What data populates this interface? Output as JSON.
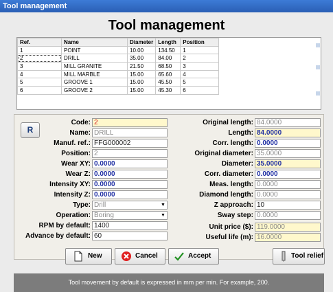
{
  "window": {
    "title": "Tool management"
  },
  "heading": "Tool management",
  "table": {
    "columns": [
      "Ref.",
      "Name",
      "Diameter",
      "Length",
      "Position"
    ],
    "rows": [
      [
        "1",
        "POINT",
        "10.00",
        "134.50",
        "1"
      ],
      [
        "2",
        "DRILL",
        "35.00",
        "84.00",
        "2"
      ],
      [
        "3",
        "MILL GRANITE",
        "21.50",
        "68.50",
        "3"
      ],
      [
        "4",
        "MILL MARBLE",
        "15.00",
        "65.60",
        "4"
      ],
      [
        "5",
        "GROOVE 1",
        "15.00",
        "45.50",
        "5"
      ],
      [
        "6",
        "GROOVE 2",
        "15.00",
        "45.30",
        "6"
      ]
    ]
  },
  "r_button": "R",
  "form_left": {
    "code": {
      "label": "Code:",
      "value": "2"
    },
    "name": {
      "label": "Name:",
      "value": "DRILL"
    },
    "manuf_ref": {
      "label": "Manuf. ref.:",
      "value": "FFG000002"
    },
    "position": {
      "label": "Position:",
      "value": "2"
    },
    "wear_xy": {
      "label": "Wear XY:",
      "value": "0.0000"
    },
    "wear_z": {
      "label": "Wear Z:",
      "value": "0.0000"
    },
    "intensity_xy": {
      "label": "Intensity XY:",
      "value": "0.0000"
    },
    "intensity_z": {
      "label": "Intensity Z:",
      "value": "0.0000"
    },
    "type": {
      "label": "Type:",
      "value": "Drill"
    },
    "operation": {
      "label": "Operation:",
      "value": "Boring"
    },
    "rpm_default": {
      "label": "RPM by default:",
      "value": "1400"
    },
    "advance_default": {
      "label": "Advance by default:",
      "value": "60"
    }
  },
  "form_right": {
    "original_length": {
      "label": "Original length:",
      "value": "84.0000"
    },
    "length": {
      "label": "Length:",
      "value": "84.0000"
    },
    "corr_length": {
      "label": "Corr. length:",
      "value": "0.0000"
    },
    "original_diameter": {
      "label": "Original diameter:",
      "value": "35.0000"
    },
    "diameter": {
      "label": "Diameter:",
      "value": "35.0000"
    },
    "corr_diameter": {
      "label": "Corr. diameter:",
      "value": "0.0000"
    },
    "meas_length": {
      "label": "Meas. length:",
      "value": "0.0000"
    },
    "diamond_length": {
      "label": "Diamond length:",
      "value": "0.0000"
    },
    "z_approach": {
      "label": "Z approach:",
      "value": "10"
    },
    "sway_step": {
      "label": "Sway step:",
      "value": "0.0000"
    },
    "unit_price": {
      "label": "Unit price ($):",
      "value": "119.0000"
    },
    "useful_life": {
      "label": "Useful life (m):",
      "value": "16.0000"
    }
  },
  "buttons": {
    "new": "New",
    "cancel": "Cancel",
    "accept": "Accept",
    "tool_relief": "Tool relief"
  },
  "status": "Tool movement by default is expressed in mm per min. For example, 200."
}
